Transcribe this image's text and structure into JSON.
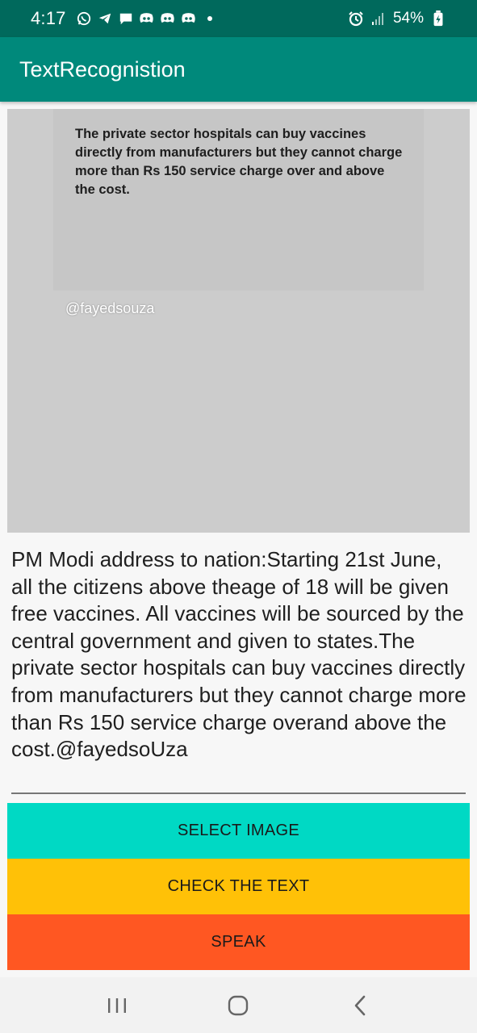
{
  "status_bar": {
    "time": "4:17",
    "battery": "54%",
    "icons": [
      "whatsapp-icon",
      "telegram-icon",
      "message-icon",
      "discord-icon",
      "discord-icon",
      "discord-icon",
      "dot-icon",
      "alarm-icon",
      "signal-icon",
      "battery-charging-icon"
    ]
  },
  "app_bar": {
    "title": "TextRecognistion"
  },
  "image": {
    "text": "The private sector hospitals can buy vaccines directly from manufacturers but they cannot charge more than Rs 150 service charge over and above the cost.",
    "handle": "@fayedsouza"
  },
  "result": {
    "text": "PM Modi address to nation:Starting 21st June, all the citizens above theage of 18 will be given free vaccines. All vaccines will be sourced by the central government and given to states.The private sector hospitals can buy vaccines directly from manufacturers but they cannot charge more than Rs 150 service charge overand above the cost.@fayedsoUza"
  },
  "buttons": {
    "select_image": "SELECT IMAGE",
    "check_text": "CHECK THE TEXT",
    "speak": "SPEAK"
  },
  "colors": {
    "status_bar": "#00695c",
    "app_bar": "#00897b",
    "select_button": "#00d9c4",
    "check_button": "#ffc107",
    "speak_button": "#ff5722"
  },
  "nav_bar": {
    "items": [
      "recent-apps-icon",
      "home-icon",
      "back-icon"
    ]
  }
}
